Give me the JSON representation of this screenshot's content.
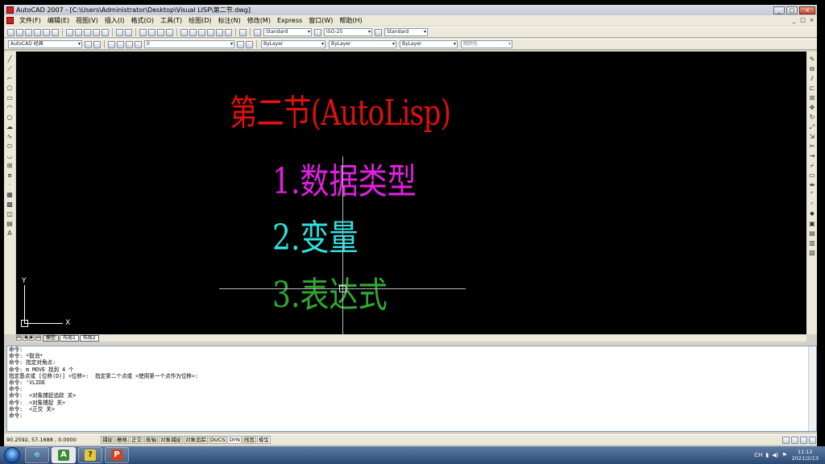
{
  "window": {
    "title": "AutoCAD 2007 - [C:\\Users\\Administrator\\Desktop\\Visual LISP\\第二节.dwg]",
    "controls": [
      "_",
      "□",
      "×"
    ]
  },
  "menu": {
    "items": [
      "文件(F)",
      "编辑(E)",
      "视图(V)",
      "插入(I)",
      "格式(O)",
      "工具(T)",
      "绘图(D)",
      "标注(N)",
      "修改(M)",
      "Express",
      "窗口(W)",
      "帮助(H)"
    ],
    "doc_controls": [
      "_",
      "□",
      "×"
    ]
  },
  "toolbar1": {
    "text_style": "Standard",
    "dim_style": "ISO-25",
    "table_style": "Standard"
  },
  "toolbar2": {
    "workspace": "AutoCAD 经典",
    "layer": "0",
    "color": "ByLayer",
    "linetype": "ByLayer",
    "lineweight": "ByLayer",
    "plot_style": "随颜色"
  },
  "drawing": {
    "title": "第二节(AutoLisp)",
    "items": [
      "1.数据类型",
      "2.变量",
      "3.表达式"
    ],
    "colors": {
      "title": "#e01010",
      "item1": "#e020e0",
      "item2": "#30e0e0",
      "item3": "#30a830"
    },
    "ucs": {
      "y_label": "Y",
      "x_label": "X"
    }
  },
  "layout_tabs": [
    "模型",
    "布局1",
    "布局2"
  ],
  "command_history": [
    "命令:",
    "命令: *取消*",
    "命令: 指定对角点:",
    "命令: m MOVE 找到 4 个",
    "指定基点或 [位移(D)] <位移>:  指定第二个点或 <使用第一个点作为位移>:",
    "命令: 'VLIDE",
    "命令:",
    "命令:  <对象捕捉追踪 关>",
    "命令:  <对象捕捉 关>",
    "命令:  <正交 关>",
    "",
    "命令:"
  ],
  "status": {
    "coords": "90.2592,  57.1688 , 0.0000",
    "buttons": [
      "捕捉",
      "栅格",
      "正交",
      "极轴",
      "对象捕捉",
      "对象追踪",
      "DUCS",
      "DYN",
      "线宽",
      "模型"
    ]
  },
  "taskbar": {
    "time": "11:12",
    "date": "2021/2/13",
    "tray_lang": "CH"
  }
}
